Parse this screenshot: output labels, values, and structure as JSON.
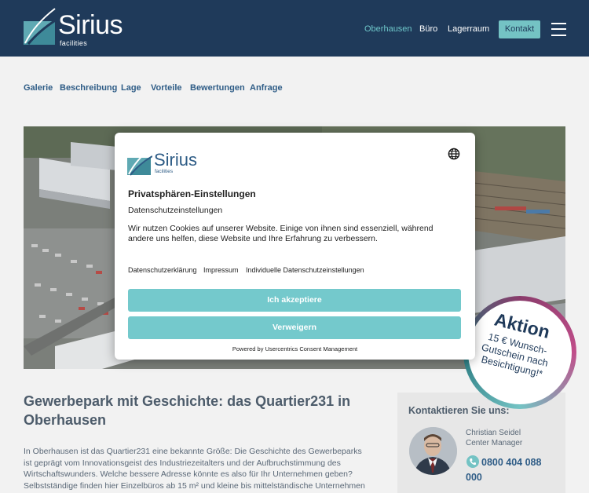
{
  "header": {
    "logo": {
      "name": "Sirius",
      "sub": "facilities"
    },
    "nav": [
      {
        "label": "Oberhausen",
        "active": true
      },
      {
        "label": "Büro",
        "active": false
      },
      {
        "label": "Lagerraum",
        "active": false
      }
    ],
    "cta_label": "Kontakt"
  },
  "subnav": [
    "Galerie",
    "Beschreibung",
    "Lage",
    "Vorteile",
    "Bewertungen",
    "Anfrage"
  ],
  "content": {
    "heading": "Gewerbepark mit Geschichte: das Quartier231 in Oberhausen",
    "paragraph": "In Oberhausen ist das Quartier231 eine bekannte Größe: Die Geschichte des Gewerbeparks ist geprägt vom Innovationsgeist des Industriezeitalters und der Aufbruchstimmung des Wirtschaftswunders. Welche bessere Adresse könnte es also für Ihr Unternehmen geben? Selbstständige finden hier Einzelbüros ab 15 m² und kleine bis mittelständische Unternehmen"
  },
  "contact": {
    "title": "Kontaktieren Sie uns:",
    "name": "Christian Seidel",
    "role": "Center Manager",
    "phone": "0800 404 088 000"
  },
  "badge": {
    "title": "Aktion",
    "text": "15 € Wunsch-Gutschein nach Besichtigung!*"
  },
  "consent": {
    "logo": {
      "name": "Sirius",
      "sub": "facilities"
    },
    "title": "Privatsphären-Einstellungen",
    "subtitle": "Datenschutzeinstellungen",
    "description": "Wir nutzen Cookies auf unserer Website. Einige von ihnen sind essenziell, während andere uns helfen, diese Website und Ihre Erfahrung zu verbessern.",
    "links": [
      "Datenschutzerklärung",
      "Impressum",
      "Individuelle Datenschutzeinstellungen"
    ],
    "accept_label": "Ich akzeptiere",
    "deny_label": "Verweigern",
    "powered_by": "Powered by Usercentrics Consent Management"
  },
  "colors": {
    "header_bg": "#1f3a5a",
    "accent": "#74c3c4",
    "link": "#2e5c86"
  }
}
